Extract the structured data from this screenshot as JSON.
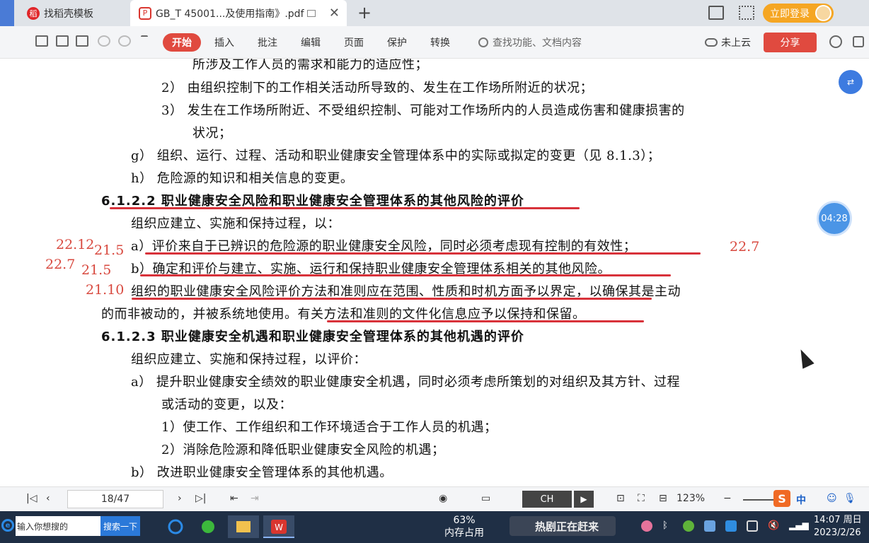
{
  "tabs": {
    "tab1_label": "找稻壳模板",
    "tab2_label": "GB_T 45001...及使用指南》.pdf",
    "close_glyph": "✕",
    "new_tab_glyph": "+"
  },
  "header": {
    "login_label": "立即登录"
  },
  "toolbar": {
    "menu": [
      "开始",
      "插入",
      "批注",
      "编辑",
      "页面",
      "保护",
      "转换"
    ],
    "search_placeholder": "查找功能、文档内容",
    "cloud_label": "未上云",
    "share_label": "分享"
  },
  "document": {
    "lines": [
      "所涉及工作人员的需求和能力的适应性；",
      "2）  由组织控制下的工作相关活动所导致的、发生在工作场所附近的状况；",
      "3）  发生在工作场所附近、不受组织控制、可能对工作场所内的人员造成伤害和健康损害的",
      "状况；",
      "g）  组织、运行、过程、活动和职业健康安全管理体系中的实际或拟定的变更（见 8.1.3）；",
      "h）  危险源的知识和相关信息的变更。",
      "6.1.2.2   职业健康安全风险和职业健康安全管理体系的其他风险的评价",
      "组织应建立、实施和保持过程，以：",
      "a）评价来自于已辨识的危险源的职业健康安全风险，同时必须考虑现有控制的有效性；",
      "b）确定和评价与建立、实施、运行和保持职业健康安全管理体系相关的其他风险。",
      "组织的职业健康安全风险评价方法和准则应在范围、性质和时机方面予以界定，以确保其是主动",
      "的而非被动的，并被系统地使用。有关方法和准则的文件化信息应予以保持和保留。",
      "6.1.2.3   职业健康安全机遇和职业健康安全管理体系的其他机遇的评价",
      "组织应建立、实施和保持过程，以评价：",
      "a）  提升职业健康安全绩效的职业健康安全机遇，同时必须考虑所策划的对组织及其方针、过程",
      "或活动的变更，以及：",
      "1）使工作、工作组织和工作环境适合于工作人员的机遇；",
      "2）消除危险源和降低职业健康安全风险的机遇；",
      "b）  改进职业健康安全管理体系的其他机遇。"
    ],
    "annotations": [
      "22.12",
      "21.5",
      "22.7",
      "22.7",
      "21.5",
      "21.10"
    ]
  },
  "overlay": {
    "timer": "04:28"
  },
  "statusbar": {
    "page": "18/47",
    "ime": "CH",
    "zoom": "123%",
    "zoom_minus": "−",
    "lang": "中",
    "sogou": "S"
  },
  "taskbar": {
    "search_placeholder": "输入你想搜的",
    "search_button": "搜索一下",
    "mem_percent": "63%",
    "mem_label": "内存占用",
    "banner": "热剧正在赶来",
    "time": "14:07 周日",
    "date": "2023/2/26"
  },
  "colors": {
    "accent_red": "#e04a3f",
    "annotation_red": "#d8493f",
    "taskbar": "#1f2f45",
    "login_orange": "#f5a623"
  }
}
